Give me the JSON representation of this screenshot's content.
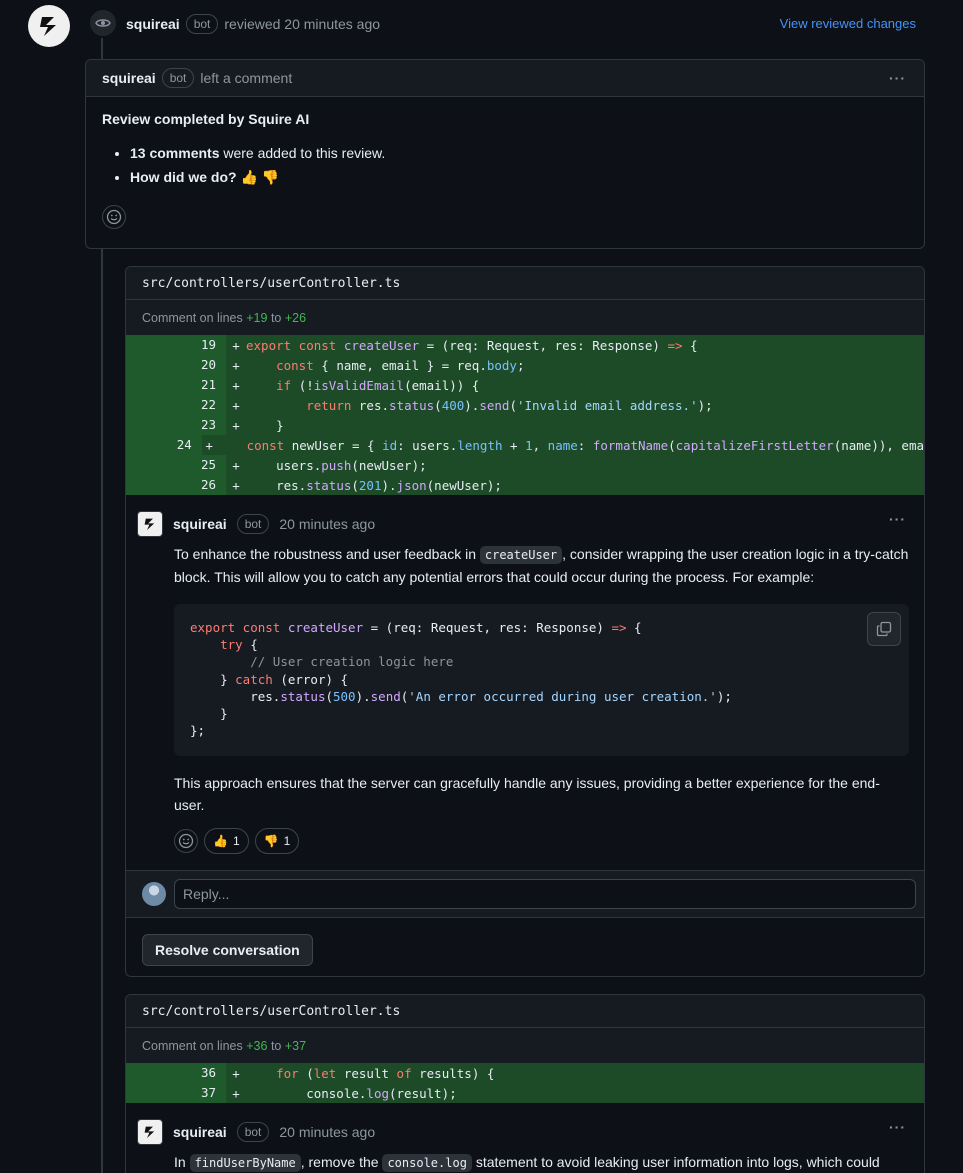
{
  "review_header": {
    "user": "squireai",
    "badge": "bot",
    "action": "reviewed 20 minutes ago",
    "view_link": "View reviewed changes"
  },
  "summary": {
    "user": "squireai",
    "badge": "bot",
    "action": "left a comment",
    "title": "Review completed by Squire AI",
    "bullet1_bold": "13 comments",
    "bullet1_rest": "were added to this review.",
    "bullet2_bold": "How did we do?",
    "bullet2_emoji": "👍 👎"
  },
  "thread1": {
    "file": "src/controllers/userController.ts",
    "lines_prefix": "Comment on lines",
    "line_from": "+19",
    "lines_to": "to",
    "line_to": "+26",
    "diff_lines": [
      "19",
      "20",
      "21",
      "22",
      "23",
      "24",
      "25",
      "26"
    ],
    "comment": {
      "user": "squireai",
      "badge": "bot",
      "time": "20 minutes ago",
      "p1_a": "To enhance the robustness and user feedback in",
      "p1_code": "createUser",
      "p1_b": ", consider wrapping the user creation logic in a try-catch block. This will allow you to catch any potential errors that could occur during the process. For example:",
      "p2": "This approach ensures that the server can gracefully handle any issues, providing a better experience for the end-user.",
      "thumbs_up_count": "1",
      "thumbs_down_count": "1"
    },
    "reply_placeholder": "Reply...",
    "resolve_label": "Resolve conversation"
  },
  "thread2": {
    "file": "src/controllers/userController.ts",
    "lines_prefix": "Comment on lines",
    "line_from": "+36",
    "lines_to": "to",
    "line_to": "+37",
    "diff_lines": [
      "36",
      "37"
    ],
    "comment": {
      "user": "squireai",
      "badge": "bot",
      "time": "20 minutes ago",
      "p1_a": "In",
      "p1_code1": "findUserByName",
      "p1_b": ", remove the",
      "p1_code2": "console.log",
      "p1_c": "statement to avoid leaking user information into logs, which could"
    }
  },
  "icons": [
    "eye-icon",
    "smiley-icon",
    "copy-icon",
    "kebab-icon",
    "squire-logo-icon"
  ]
}
